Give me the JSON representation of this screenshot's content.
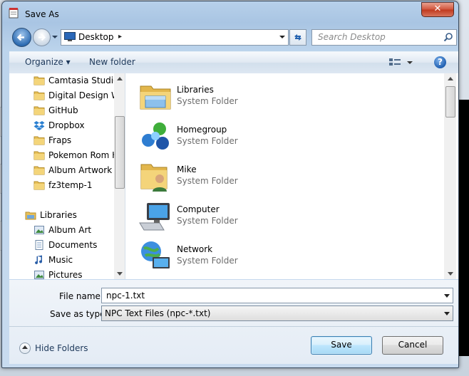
{
  "window": {
    "title": "Save As",
    "close_glyph": "✕"
  },
  "address": {
    "location": "Desktop",
    "separator": "▸",
    "search_placeholder": "Search Desktop"
  },
  "toolbar": {
    "organize_label": "Organize ▾",
    "new_folder_label": "New folder",
    "help_glyph": "?"
  },
  "nav_pane": {
    "items": [
      {
        "label": "Camtasia Studio",
        "icon": "folder-icon"
      },
      {
        "label": "Digital Design Wo",
        "icon": "folder-icon"
      },
      {
        "label": "GitHub",
        "icon": "folder-icon"
      },
      {
        "label": "Dropbox",
        "icon": "dropbox-icon"
      },
      {
        "label": "Fraps",
        "icon": "folder-icon"
      },
      {
        "label": "Pokemon Rom H",
        "icon": "folder-icon"
      },
      {
        "label": "Album Artwork",
        "icon": "folder-icon"
      },
      {
        "label": "fz3temp-1",
        "icon": "folder-icon"
      },
      {
        "label": "Libraries",
        "icon": "libraries-icon"
      },
      {
        "label": "Album Art",
        "icon": "pictures-icon"
      },
      {
        "label": "Documents",
        "icon": "documents-icon"
      },
      {
        "label": "Music",
        "icon": "music-icon"
      },
      {
        "label": "Pictures",
        "icon": "pictures-icon"
      }
    ]
  },
  "files": [
    {
      "name": "Libraries",
      "type": "System Folder",
      "icon": "libraries-icon"
    },
    {
      "name": "Homegroup",
      "type": "System Folder",
      "icon": "homegroup-icon"
    },
    {
      "name": "Mike",
      "type": "System Folder",
      "icon": "user-folder-icon"
    },
    {
      "name": "Computer",
      "type": "System Folder",
      "icon": "computer-icon"
    },
    {
      "name": "Network",
      "type": "System Folder",
      "icon": "network-icon"
    }
  ],
  "form": {
    "file_name_label": "File name:",
    "file_name_value": "npc-1.txt",
    "save_type_label": "Save as type:",
    "save_type_value": "NPC Text Files (npc-*.txt)"
  },
  "footer": {
    "hide_folders_label": "Hide Folders",
    "save_label": "Save",
    "cancel_label": "Cancel"
  }
}
